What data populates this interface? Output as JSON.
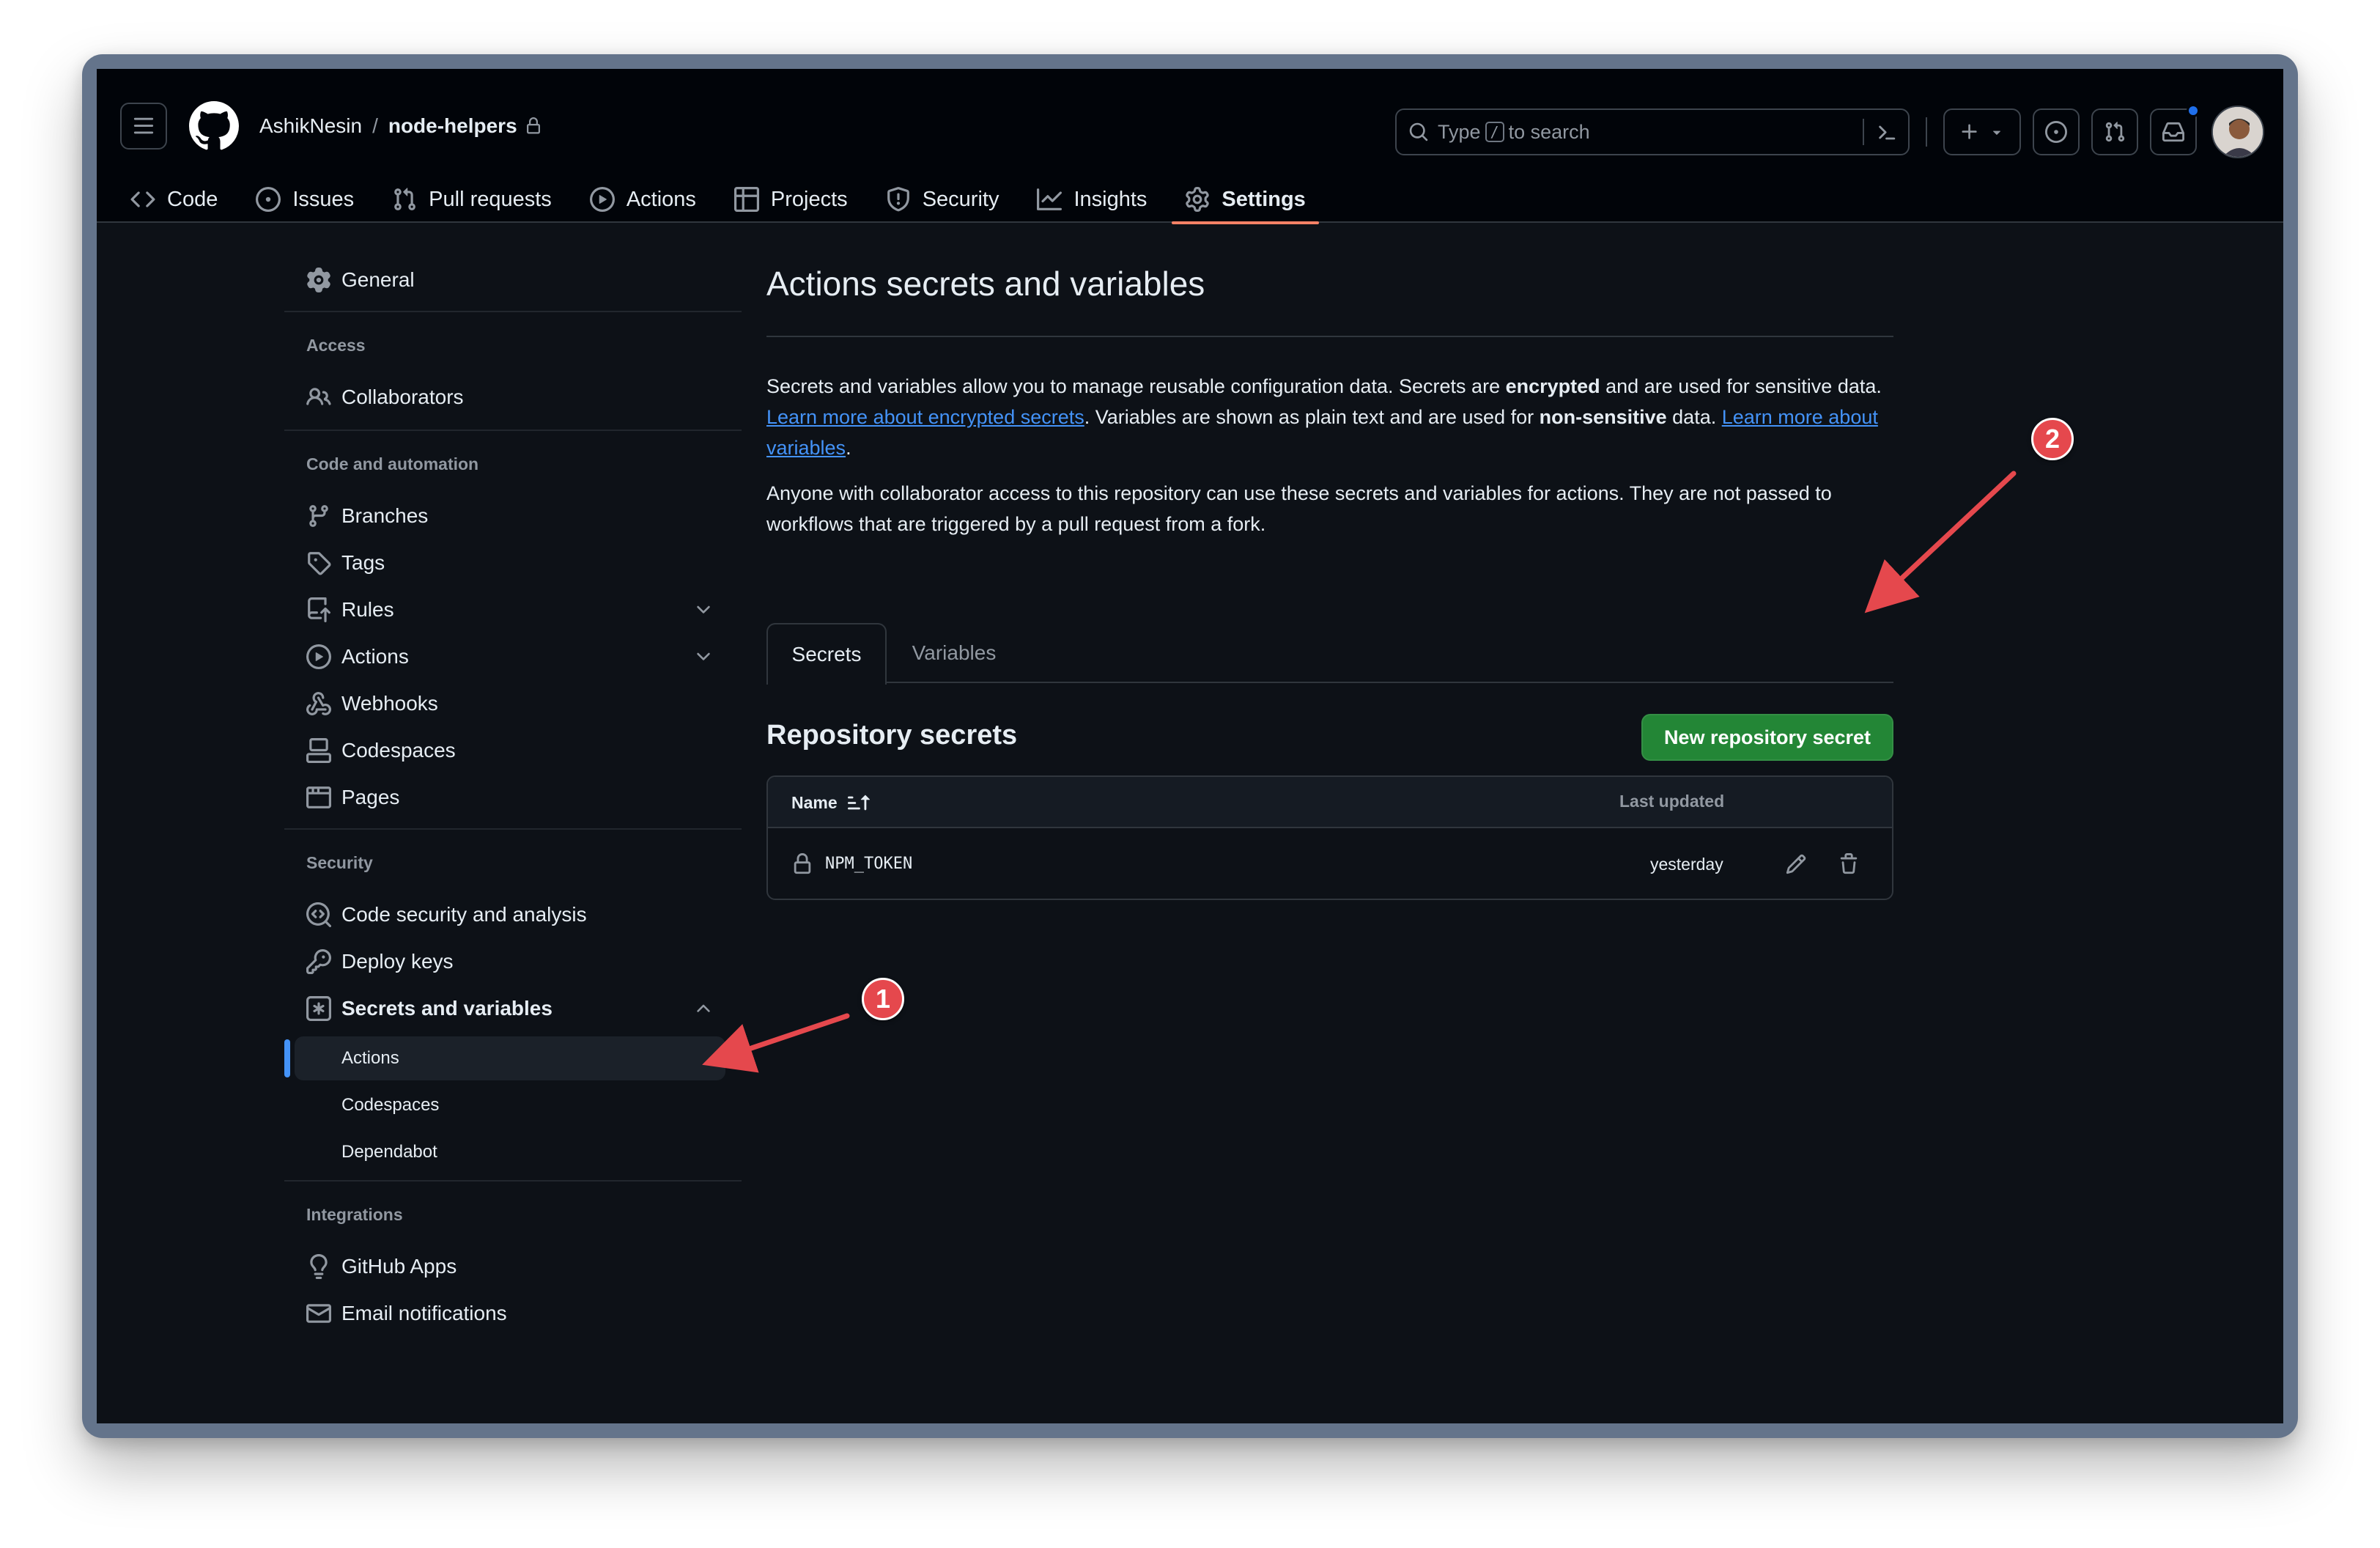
{
  "header": {
    "owner": "AshikNesin",
    "separator": "/",
    "repo": "node-helpers",
    "search": {
      "prefix": "Type",
      "key": "/",
      "suffix": "to search"
    }
  },
  "repo_tabs": [
    {
      "label": "Code",
      "icon": "code-icon"
    },
    {
      "label": "Issues",
      "icon": "issue-icon"
    },
    {
      "label": "Pull requests",
      "icon": "pull-request-icon"
    },
    {
      "label": "Actions",
      "icon": "play-icon"
    },
    {
      "label": "Projects",
      "icon": "table-icon"
    },
    {
      "label": "Security",
      "icon": "shield-icon"
    },
    {
      "label": "Insights",
      "icon": "graph-icon"
    },
    {
      "label": "Settings",
      "icon": "gear-icon",
      "active": true
    }
  ],
  "sidebar": {
    "general": "General",
    "access_heading": "Access",
    "collaborators": "Collaborators",
    "code_heading": "Code and automation",
    "branches": "Branches",
    "tags": "Tags",
    "rules": "Rules",
    "actions": "Actions",
    "webhooks": "Webhooks",
    "codespaces": "Codespaces",
    "pages": "Pages",
    "security_heading": "Security",
    "code_security": "Code security and analysis",
    "deploy_keys": "Deploy keys",
    "secrets_vars": "Secrets and variables",
    "sub_actions": "Actions",
    "sub_codespaces": "Codespaces",
    "sub_dependabot": "Dependabot",
    "integrations_heading": "Integrations",
    "github_apps": "GitHub Apps",
    "email_notifications": "Email notifications"
  },
  "main": {
    "title": "Actions secrets and variables",
    "p1": {
      "t1": "Secrets and variables allow you to manage reusable configuration data. Secrets are ",
      "b1": "encrypted",
      "t2": " and are used for sensitive data. ",
      "link1": "Learn more about encrypted secrets",
      "t3": ". Variables are shown as plain text and are used for ",
      "b2": "non-sensitive",
      "t4": " data. ",
      "link2": "Learn more about variables",
      "t5": "."
    },
    "p2": "Anyone with collaborator access to this repository can use these secrets and variables for actions. They are not passed to workflows that are triggered by a pull request from a fork.",
    "tabs": [
      "Secrets",
      "Variables"
    ],
    "section_title": "Repository secrets",
    "new_button": "New repository secret",
    "table": {
      "col_name": "Name",
      "col_updated": "Last updated",
      "rows": [
        {
          "name": "NPM_TOKEN",
          "updated": "yesterday"
        }
      ]
    }
  },
  "annotations": {
    "one": "1",
    "two": "2",
    "color": "#e5484d"
  },
  "colors": {
    "accent_tab": "#f78166",
    "link": "#4493f8",
    "button": "#238636",
    "bg": "#0d1117"
  }
}
